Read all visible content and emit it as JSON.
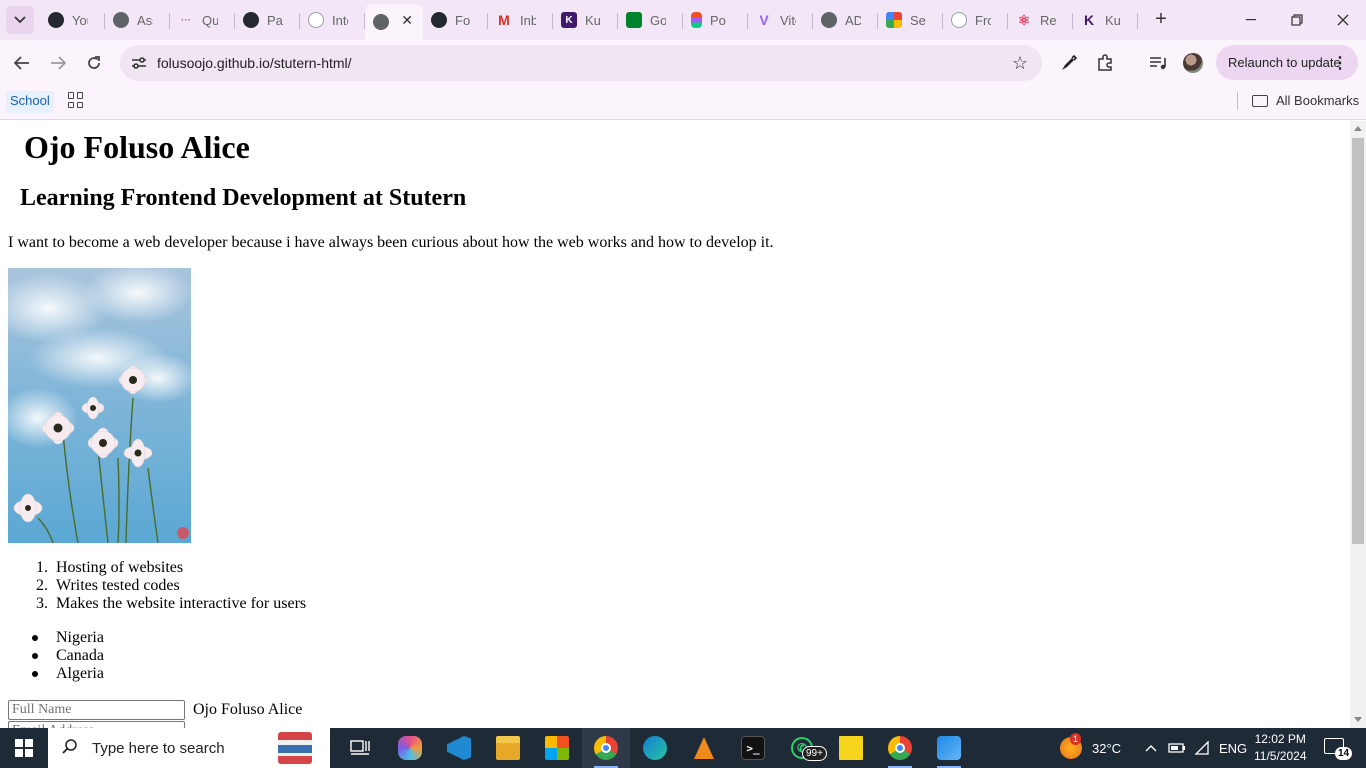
{
  "browser": {
    "tabs": [
      {
        "title": "You",
        "icon": "github-icon",
        "color": "#24292f"
      },
      {
        "title": "Ass",
        "icon": "globe-icon",
        "color": "#5f6368"
      },
      {
        "title": "Qui",
        "icon": "dots-icon",
        "color": "#b06cc0"
      },
      {
        "title": "Pag",
        "icon": "github-icon",
        "color": "#24292f"
      },
      {
        "title": "Inte",
        "icon": "loading-icon",
        "color": "#9aa0a6"
      },
      {
        "title": "Fol",
        "icon": "github-icon",
        "color": "#24292f"
      },
      {
        "title": "Inb",
        "icon": "gmail-icon",
        "color": "#d93025"
      },
      {
        "title": "Kuc",
        "icon": "kuda-icon",
        "color": "#40196d"
      },
      {
        "title": "Goo",
        "icon": "google-meet-icon",
        "color": "#00832d"
      },
      {
        "title": "Por",
        "icon": "figma-icon",
        "color": "#f24e1e"
      },
      {
        "title": "Vite",
        "icon": "vite-icon",
        "color": "#9461fe"
      },
      {
        "title": "ADI",
        "icon": "globe-icon",
        "color": "#5f6368"
      },
      {
        "title": "Sel",
        "icon": "colorful-icon",
        "color": "#34a853"
      },
      {
        "title": "Fro",
        "icon": "loading-icon",
        "color": "#9aa0a6"
      },
      {
        "title": "Rea",
        "icon": "react-icon",
        "color": "#e8476a"
      },
      {
        "title": "Kuc",
        "icon": "kuda-icon",
        "color": "#40196d"
      }
    ],
    "active_tab_icon": "globe-icon",
    "url": "folusoojo.github.io/stutern-html/",
    "relaunch_label": "Relaunch to update",
    "bookmarks": {
      "school": "School",
      "all_bookmarks": "All Bookmarks"
    }
  },
  "page": {
    "name": "Ojo Foluso Alice",
    "subtitle": "Learning Frontend Development at Stutern",
    "intro": "I want to become a web developer because i have always been curious about how the web works and how to develop it.",
    "ordered_list": [
      {
        "num": "1.",
        "text": "Hosting of websites"
      },
      {
        "num": "2.",
        "text": "Writes tested codes"
      },
      {
        "num": "3.",
        "text": "Makes the website interactive for users"
      }
    ],
    "unordered_list": [
      "Nigeria",
      "Canada",
      "Algeria"
    ],
    "form": {
      "fullname_placeholder": "Full Name",
      "fullname_display": "Ojo Foluso Alice",
      "email_placeholder": "Email Address"
    }
  },
  "taskbar": {
    "search_placeholder": "Type here to search",
    "whatsapp_badge": "99+",
    "weather_badge": "1",
    "temperature": "32°C",
    "language": "ENG",
    "time": "12:02 PM",
    "date": "11/5/2024",
    "notifications": "14"
  }
}
